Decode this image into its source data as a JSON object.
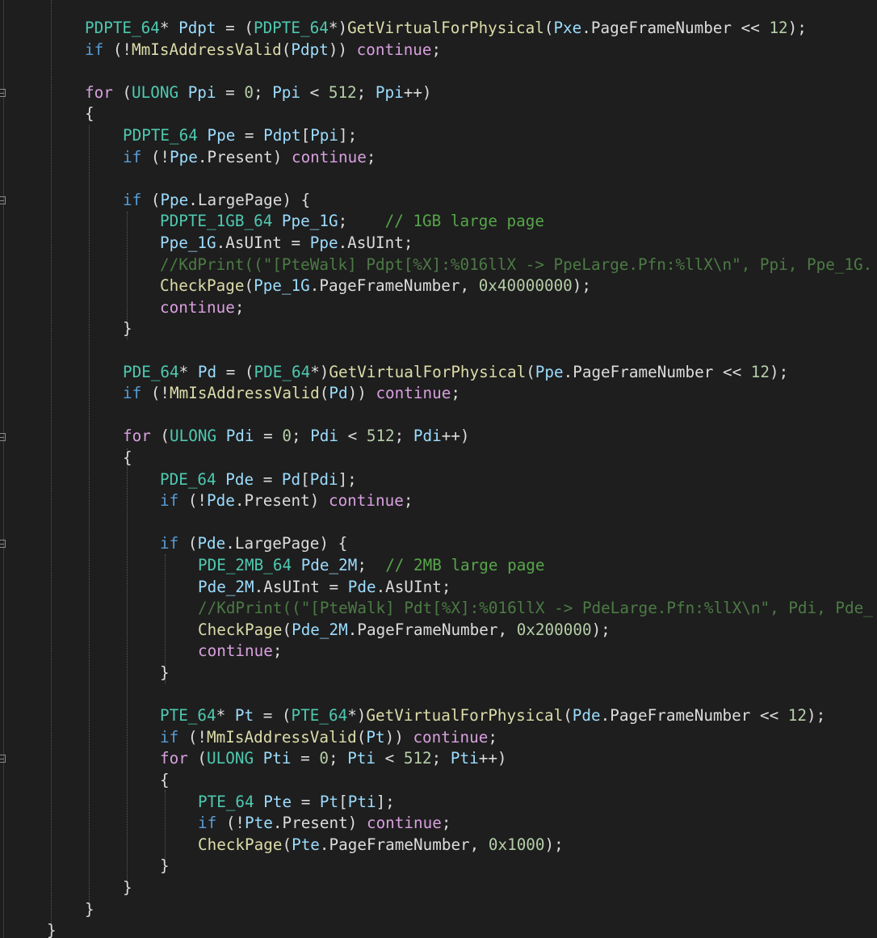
{
  "colors": {
    "background": "#1e1e1e",
    "keyword_control": "#d8a0df",
    "keyword_type": "#569cd6",
    "type": "#4ec9b0",
    "function": "#dcdcaa",
    "variable": "#9cdcfe",
    "number": "#b5cea8",
    "comment": "#57a64a",
    "plain": "#dcdcdc"
  },
  "lines": [
    {
      "tokens": [
        [
          "type",
          "PDPTE_64"
        ],
        [
          "plain",
          "* "
        ],
        [
          "var",
          "Pdpt"
        ],
        [
          "plain",
          " = ("
        ],
        [
          "type",
          "PDPTE_64"
        ],
        [
          "plain",
          "*)"
        ],
        [
          "fn",
          "GetVirtualForPhysical"
        ],
        [
          "plain",
          "("
        ],
        [
          "var",
          "Pxe"
        ],
        [
          "plain",
          "."
        ],
        [
          "plain",
          "PageFrameNumber"
        ],
        [
          "plain",
          " << "
        ],
        [
          "num",
          "12"
        ],
        [
          "plain",
          ");"
        ]
      ]
    },
    {
      "tokens": [
        [
          "kwb",
          "if"
        ],
        [
          "plain",
          " (!"
        ],
        [
          "fn",
          "MmIsAddressValid"
        ],
        [
          "plain",
          "("
        ],
        [
          "var",
          "Pdpt"
        ],
        [
          "plain",
          ")) "
        ],
        [
          "kw",
          "continue"
        ],
        [
          "plain",
          ";"
        ]
      ]
    },
    {
      "tokens": []
    },
    {
      "tokens": [
        [
          "kw",
          "for"
        ],
        [
          "plain",
          " ("
        ],
        [
          "type",
          "ULONG"
        ],
        [
          "plain",
          " "
        ],
        [
          "var",
          "Ppi"
        ],
        [
          "plain",
          " = "
        ],
        [
          "num",
          "0"
        ],
        [
          "plain",
          "; "
        ],
        [
          "var",
          "Ppi"
        ],
        [
          "plain",
          " < "
        ],
        [
          "num",
          "512"
        ],
        [
          "plain",
          "; "
        ],
        [
          "var",
          "Ppi"
        ],
        [
          "plain",
          "++)"
        ]
      ]
    },
    {
      "tokens": [
        [
          "plain",
          "{"
        ]
      ]
    },
    {
      "tokens": [
        [
          "type",
          "PDPTE_64"
        ],
        [
          "plain",
          " "
        ],
        [
          "var",
          "Ppe"
        ],
        [
          "plain",
          " = "
        ],
        [
          "var",
          "Pdpt"
        ],
        [
          "plain",
          "["
        ],
        [
          "var",
          "Ppi"
        ],
        [
          "plain",
          "];"
        ]
      ]
    },
    {
      "tokens": [
        [
          "kwb",
          "if"
        ],
        [
          "plain",
          " (!"
        ],
        [
          "var",
          "Ppe"
        ],
        [
          "plain",
          ".Present) "
        ],
        [
          "kw",
          "continue"
        ],
        [
          "plain",
          ";"
        ]
      ]
    },
    {
      "tokens": []
    },
    {
      "tokens": [
        [
          "kwb",
          "if"
        ],
        [
          "plain",
          " ("
        ],
        [
          "var",
          "Ppe"
        ],
        [
          "plain",
          ".LargePage) {"
        ]
      ]
    },
    {
      "tokens": [
        [
          "type",
          "PDPTE_1GB_64"
        ],
        [
          "plain",
          " "
        ],
        [
          "var",
          "Ppe_1G"
        ],
        [
          "plain",
          ";    "
        ],
        [
          "cmt",
          "// 1GB large page"
        ]
      ]
    },
    {
      "tokens": [
        [
          "var",
          "Ppe_1G"
        ],
        [
          "plain",
          ".AsUInt = "
        ],
        [
          "var",
          "Ppe"
        ],
        [
          "plain",
          ".AsUInt;"
        ]
      ]
    },
    {
      "tokens": [
        [
          "cmtd",
          "//KdPrint((\"[PteWalk] Pdpt[%X]:%016llX -> PpeLarge.Pfn:%llX\\n\", Ppi, Ppe_1G."
        ]
      ]
    },
    {
      "tokens": [
        [
          "fn",
          "CheckPage"
        ],
        [
          "plain",
          "("
        ],
        [
          "var",
          "Ppe_1G"
        ],
        [
          "plain",
          ".PageFrameNumber, "
        ],
        [
          "num",
          "0x40000000"
        ],
        [
          "plain",
          ");"
        ]
      ]
    },
    {
      "tokens": [
        [
          "kw",
          "continue"
        ],
        [
          "plain",
          ";"
        ]
      ]
    },
    {
      "tokens": [
        [
          "plain",
          "}"
        ]
      ]
    },
    {
      "tokens": []
    },
    {
      "tokens": [
        [
          "type",
          "PDE_64"
        ],
        [
          "plain",
          "* "
        ],
        [
          "var",
          "Pd"
        ],
        [
          "plain",
          " = ("
        ],
        [
          "type",
          "PDE_64"
        ],
        [
          "plain",
          "*)"
        ],
        [
          "fn",
          "GetVirtualForPhysical"
        ],
        [
          "plain",
          "("
        ],
        [
          "var",
          "Ppe"
        ],
        [
          "plain",
          ".PageFrameNumber << "
        ],
        [
          "num",
          "12"
        ],
        [
          "plain",
          ");"
        ]
      ]
    },
    {
      "tokens": [
        [
          "kwb",
          "if"
        ],
        [
          "plain",
          " (!"
        ],
        [
          "fn",
          "MmIsAddressValid"
        ],
        [
          "plain",
          "("
        ],
        [
          "var",
          "Pd"
        ],
        [
          "plain",
          ")) "
        ],
        [
          "kw",
          "continue"
        ],
        [
          "plain",
          ";"
        ]
      ]
    },
    {
      "tokens": []
    },
    {
      "tokens": [
        [
          "kw",
          "for"
        ],
        [
          "plain",
          " ("
        ],
        [
          "type",
          "ULONG"
        ],
        [
          "plain",
          " "
        ],
        [
          "var",
          "Pdi"
        ],
        [
          "plain",
          " = "
        ],
        [
          "num",
          "0"
        ],
        [
          "plain",
          "; "
        ],
        [
          "var",
          "Pdi"
        ],
        [
          "plain",
          " < "
        ],
        [
          "num",
          "512"
        ],
        [
          "plain",
          "; "
        ],
        [
          "var",
          "Pdi"
        ],
        [
          "plain",
          "++)"
        ]
      ]
    },
    {
      "tokens": [
        [
          "plain",
          "{"
        ]
      ]
    },
    {
      "tokens": [
        [
          "type",
          "PDE_64"
        ],
        [
          "plain",
          " "
        ],
        [
          "var",
          "Pde"
        ],
        [
          "plain",
          " = "
        ],
        [
          "var",
          "Pd"
        ],
        [
          "plain",
          "["
        ],
        [
          "var",
          "Pdi"
        ],
        [
          "plain",
          "];"
        ]
      ]
    },
    {
      "tokens": [
        [
          "kwb",
          "if"
        ],
        [
          "plain",
          " (!"
        ],
        [
          "var",
          "Pde"
        ],
        [
          "plain",
          ".Present) "
        ],
        [
          "kw",
          "continue"
        ],
        [
          "plain",
          ";"
        ]
      ]
    },
    {
      "tokens": []
    },
    {
      "tokens": [
        [
          "kwb",
          "if"
        ],
        [
          "plain",
          " ("
        ],
        [
          "var",
          "Pde"
        ],
        [
          "plain",
          ".LargePage) {"
        ]
      ]
    },
    {
      "tokens": [
        [
          "type",
          "PDE_2MB_64"
        ],
        [
          "plain",
          " "
        ],
        [
          "var",
          "Pde_2M"
        ],
        [
          "plain",
          ";  "
        ],
        [
          "cmt",
          "// 2MB large page"
        ]
      ]
    },
    {
      "tokens": [
        [
          "var",
          "Pde_2M"
        ],
        [
          "plain",
          ".AsUInt = "
        ],
        [
          "var",
          "Pde"
        ],
        [
          "plain",
          ".AsUInt;"
        ]
      ]
    },
    {
      "tokens": [
        [
          "cmtd",
          "//KdPrint((\"[PteWalk] Pdt[%X]:%016llX -> PdeLarge.Pfn:%llX\\n\", Pdi, Pde_"
        ]
      ]
    },
    {
      "tokens": [
        [
          "fn",
          "CheckPage"
        ],
        [
          "plain",
          "("
        ],
        [
          "var",
          "Pde_2M"
        ],
        [
          "plain",
          ".PageFrameNumber, "
        ],
        [
          "num",
          "0x200000"
        ],
        [
          "plain",
          ");"
        ]
      ]
    },
    {
      "tokens": [
        [
          "kw",
          "continue"
        ],
        [
          "plain",
          ";"
        ]
      ]
    },
    {
      "tokens": [
        [
          "plain",
          "}"
        ]
      ]
    },
    {
      "tokens": []
    },
    {
      "tokens": [
        [
          "type",
          "PTE_64"
        ],
        [
          "plain",
          "* "
        ],
        [
          "var",
          "Pt"
        ],
        [
          "plain",
          " = ("
        ],
        [
          "type",
          "PTE_64"
        ],
        [
          "plain",
          "*)"
        ],
        [
          "fn",
          "GetVirtualForPhysical"
        ],
        [
          "plain",
          "("
        ],
        [
          "var",
          "Pde"
        ],
        [
          "plain",
          ".PageFrameNumber << "
        ],
        [
          "num",
          "12"
        ],
        [
          "plain",
          ");"
        ]
      ]
    },
    {
      "tokens": [
        [
          "kwb",
          "if"
        ],
        [
          "plain",
          " (!"
        ],
        [
          "fn",
          "MmIsAddressValid"
        ],
        [
          "plain",
          "("
        ],
        [
          "var",
          "Pt"
        ],
        [
          "plain",
          ")) "
        ],
        [
          "kw",
          "continue"
        ],
        [
          "plain",
          ";"
        ]
      ]
    },
    {
      "tokens": [
        [
          "kw",
          "for"
        ],
        [
          "plain",
          " ("
        ],
        [
          "type",
          "ULONG"
        ],
        [
          "plain",
          " "
        ],
        [
          "var",
          "Pti"
        ],
        [
          "plain",
          " = "
        ],
        [
          "num",
          "0"
        ],
        [
          "plain",
          "; "
        ],
        [
          "var",
          "Pti"
        ],
        [
          "plain",
          " < "
        ],
        [
          "num",
          "512"
        ],
        [
          "plain",
          "; "
        ],
        [
          "var",
          "Pti"
        ],
        [
          "plain",
          "++)"
        ]
      ]
    },
    {
      "tokens": [
        [
          "plain",
          "{"
        ]
      ]
    },
    {
      "tokens": [
        [
          "type",
          "PTE_64"
        ],
        [
          "plain",
          " "
        ],
        [
          "var",
          "Pte"
        ],
        [
          "plain",
          " = "
        ],
        [
          "var",
          "Pt"
        ],
        [
          "plain",
          "["
        ],
        [
          "var",
          "Pti"
        ],
        [
          "plain",
          "];"
        ]
      ]
    },
    {
      "tokens": [
        [
          "kwb",
          "if"
        ],
        [
          "plain",
          " (!"
        ],
        [
          "var",
          "Pte"
        ],
        [
          "plain",
          ".Present) "
        ],
        [
          "kw",
          "continue"
        ],
        [
          "plain",
          ";"
        ]
      ]
    },
    {
      "tokens": [
        [
          "fn",
          "CheckPage"
        ],
        [
          "plain",
          "("
        ],
        [
          "var",
          "Pte"
        ],
        [
          "plain",
          ".PageFrameNumber, "
        ],
        [
          "num",
          "0x1000"
        ],
        [
          "plain",
          ");"
        ]
      ]
    },
    {
      "tokens": [
        [
          "plain",
          "}"
        ]
      ]
    },
    {
      "tokens": [
        [
          "plain",
          "}"
        ]
      ]
    },
    {
      "tokens": [
        [
          "plain",
          "}"
        ]
      ]
    },
    {
      "tokens": [
        [
          "plain",
          "}"
        ]
      ]
    }
  ]
}
